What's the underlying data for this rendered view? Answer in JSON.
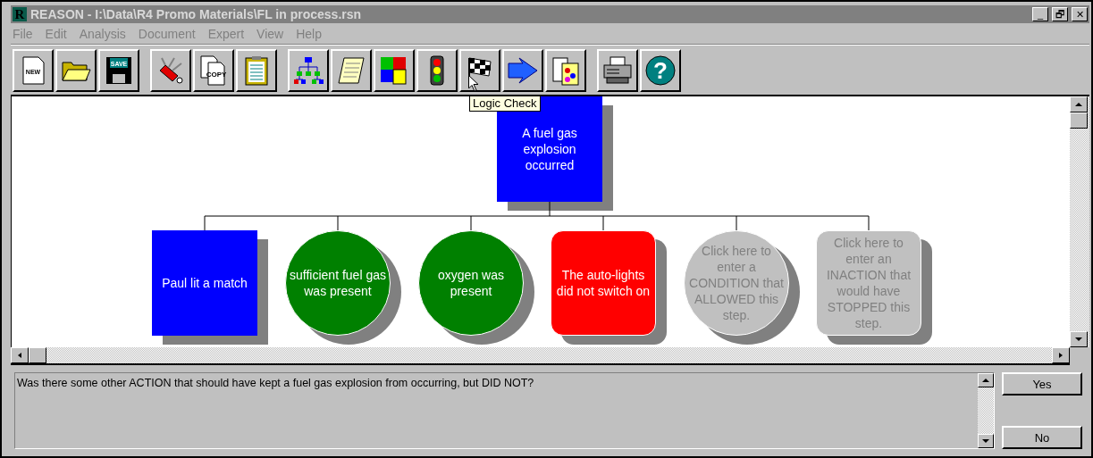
{
  "window": {
    "icon_letter": "R",
    "title": "REASON - I:\\Data\\R4 Promo Materials\\FL in process.rsn",
    "controls": [
      "_",
      "🗗",
      "✕"
    ]
  },
  "menu": [
    {
      "label": "File",
      "disabled": true
    },
    {
      "label": "Edit",
      "disabled": true
    },
    {
      "label": "Analysis",
      "disabled": true
    },
    {
      "label": "Document",
      "disabled": true
    },
    {
      "label": "Expert",
      "disabled": true
    },
    {
      "label": "View",
      "disabled": true
    },
    {
      "label": "Help",
      "disabled": true
    }
  ],
  "toolbar": [
    [
      {
        "kind": "new",
        "text": "NEW"
      },
      {
        "kind": "open"
      },
      {
        "kind": "save",
        "text": "SAVE"
      }
    ],
    [
      {
        "kind": "knife"
      },
      {
        "kind": "copy",
        "text": "COPY"
      },
      {
        "kind": "clipboard"
      }
    ],
    [
      {
        "kind": "tree"
      },
      {
        "kind": "scroll"
      },
      {
        "kind": "puzzle"
      },
      {
        "kind": "traffic"
      },
      {
        "kind": "flag"
      },
      {
        "kind": "arrow"
      },
      {
        "kind": "report"
      }
    ],
    [
      {
        "kind": "printer"
      },
      {
        "kind": "help",
        "text": "?"
      }
    ]
  ],
  "tooltip": "Logic Check",
  "diagram": {
    "root": {
      "text": "A fuel gas explosion occurred",
      "kind": "square",
      "color": "#0000ff"
    },
    "children": [
      {
        "text": "Paul lit a match",
        "kind": "square",
        "color": "#0000ff",
        "placeholder": false
      },
      {
        "text": "sufficient fuel gas was present",
        "kind": "circle",
        "color": "#008000",
        "placeholder": false
      },
      {
        "text": "oxygen was present",
        "kind": "circle",
        "color": "#008000",
        "placeholder": false
      },
      {
        "text": "The auto-lights did not switch on",
        "kind": "rounded",
        "color": "#ff0000",
        "placeholder": false
      },
      {
        "text": "Click here to enter a CONDITION that ALLOWED this step.",
        "kind": "circle",
        "color": "#c0c0c0",
        "placeholder": true
      },
      {
        "text": "Click here to enter an INACTION that would have STOPPED this step.",
        "kind": "rounded",
        "color": "#c0c0c0",
        "placeholder": true
      }
    ]
  },
  "question": "Was there some other ACTION that should have kept a fuel gas explosion from occurring, but DID NOT?",
  "buttons": [
    "Yes",
    "No"
  ]
}
